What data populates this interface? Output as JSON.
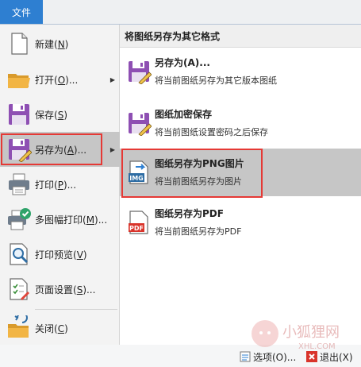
{
  "file_tab": "文件",
  "menu": [
    {
      "label": "新建(",
      "key": "N",
      "suffix": ")",
      "icon": "new-document-icon"
    },
    {
      "label": "打开(",
      "key": "O",
      "suffix": ")...",
      "icon": "folder-open-icon",
      "has_submenu": true
    },
    {
      "label": "保存(",
      "key": "S",
      "suffix": ")",
      "icon": "save-disk-icon"
    },
    {
      "label": "另存为(",
      "key": "A",
      "suffix": ")...",
      "icon": "save-as-disk-icon",
      "has_submenu": true,
      "selected": true
    },
    {
      "label": "打印(",
      "key": "P",
      "suffix": ")...",
      "icon": "printer-icon"
    },
    {
      "label": "多图幅打印(",
      "key": "M",
      "suffix": ")...",
      "icon": "batch-print-icon"
    },
    {
      "label": "打印预览(",
      "key": "V",
      "suffix": ")",
      "icon": "print-preview-icon"
    },
    {
      "label": "页面设置(",
      "key": "S",
      "suffix": ")...",
      "icon": "page-setup-icon"
    },
    {
      "label": "关闭(",
      "key": "C",
      "suffix": ")",
      "icon": "close-folder-icon"
    }
  ],
  "submenu": {
    "title": "将图纸另存为其它格式",
    "items": [
      {
        "title": "另存为(A)...",
        "desc": "将当前图纸另存为其它版本图纸",
        "icon": "save-as-disk-icon"
      },
      {
        "title": "图纸加密保存",
        "desc": "将当前图纸设置密码之后保存",
        "icon": "encrypt-save-icon"
      },
      {
        "title": "图纸另存为PNG图片",
        "desc": "将当前图纸另存为图片",
        "icon": "img-export-icon",
        "selected": true
      },
      {
        "title": "图纸另存为PDF",
        "desc": "将当前图纸另存为PDF",
        "icon": "pdf-export-icon"
      }
    ]
  },
  "bottom": {
    "options_label": "选项(O)...",
    "exit_label": "退出(X)"
  },
  "watermark": {
    "text": "小狐狸网",
    "url": "XHL.COM"
  },
  "colors": {
    "accent": "#2e7fd1",
    "highlight": "#c6c6c6",
    "callout": "#e53935",
    "disk_purple": "#8e4fb3"
  }
}
